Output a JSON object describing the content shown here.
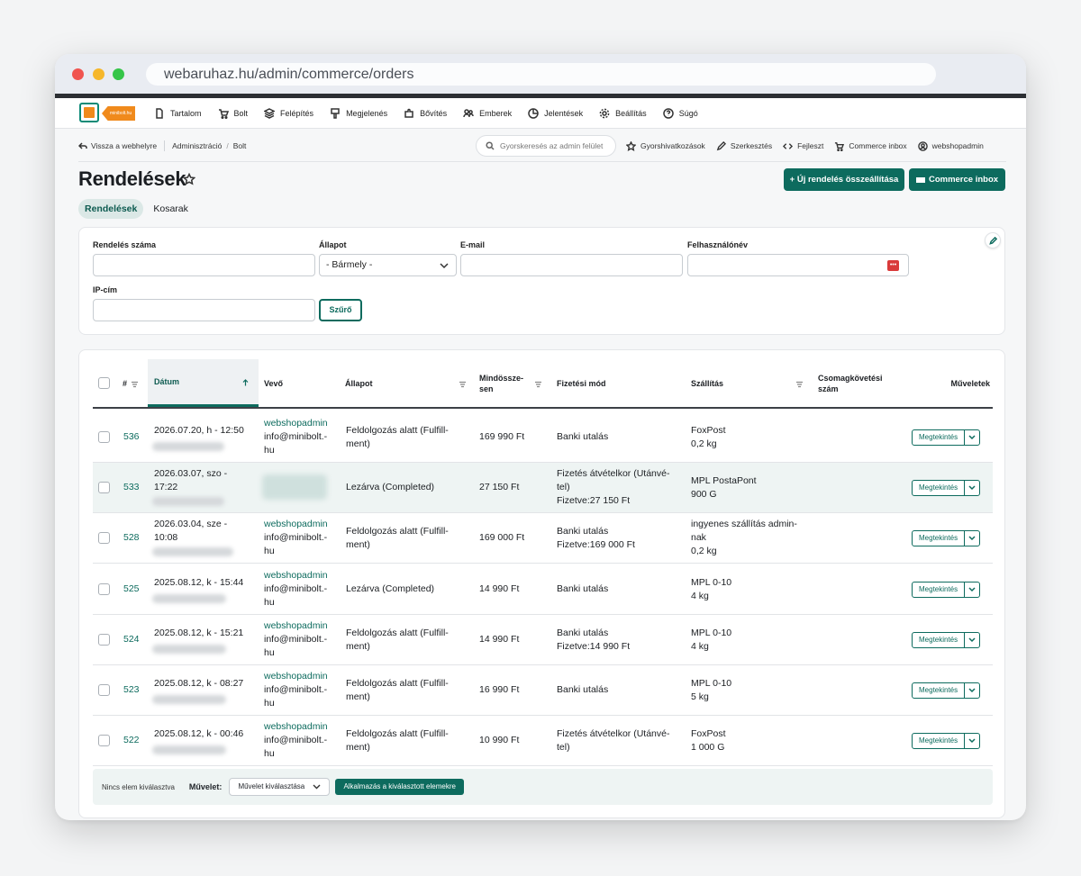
{
  "browser": {
    "url": "webaruhaz.hu/admin/commerce/orders"
  },
  "logo": {
    "text": "minibolt.hu"
  },
  "menu": [
    {
      "label": "Tartalom",
      "icon": "file-icon"
    },
    {
      "label": "Bolt",
      "icon": "cart-icon"
    },
    {
      "label": "Felépítés",
      "icon": "layers-icon"
    },
    {
      "label": "Megjelenés",
      "icon": "brush-icon"
    },
    {
      "label": "Bővítés",
      "icon": "puzzle-icon"
    },
    {
      "label": "Emberek",
      "icon": "people-icon"
    },
    {
      "label": "Jelentések",
      "icon": "chart-icon"
    },
    {
      "label": "Beállítás",
      "icon": "gear-icon"
    },
    {
      "label": "Súgó",
      "icon": "help-icon"
    }
  ],
  "subbar": {
    "back": "Vissza a webhelyre",
    "crumb1": "Adminisztráció",
    "crumb2": "Bolt",
    "search_placeholder": "Gyorskeresés az admin felület",
    "shortcuts": "Gyorshivatkozások",
    "edit": "Szerkesztés",
    "develop": "Fejleszt",
    "inbox": "Commerce inbox",
    "user": "webshopadmin"
  },
  "page": {
    "title": "Rendelések",
    "new_order": "+ Új rendelés összeállítása",
    "inbox_btn": "Commerce inbox",
    "tabs": [
      "Rendelések",
      "Kosarak"
    ]
  },
  "filters": {
    "order_number": "Rendelés száma",
    "status": "Állapot",
    "status_value": "- Bármely -",
    "email": "E-mail",
    "username": "Felhasználónév",
    "ip": "IP-cím",
    "submit": "Szűrő"
  },
  "table": {
    "headers": {
      "num": "#",
      "date": "Dátum",
      "customer": "Vevő",
      "status": "Állapot",
      "total": "Mindössze-\nsen",
      "payment": "Fizetési mód",
      "shipping": "Szállítás",
      "tracking": "Csomagkövetési\nszám",
      "actions": "Műveletek"
    },
    "view_label": "Megtekintés",
    "rows": [
      {
        "id": "536",
        "date": "2026.07.20, h - 12:50",
        "name": "webshopadmin",
        "email": "info@minibolt.-\nhu",
        "status": "Feldolgozás alatt (Fulfill-\nment)",
        "total": "169 990 Ft",
        "payment": "Banki utalás",
        "shipping": "FoxPost\n0,2 kg"
      },
      {
        "id": "533",
        "date": "2026.03.07, szo -\n17:22",
        "name": "",
        "email": "",
        "status": "Lezárva (Completed)",
        "total": "27 150 Ft",
        "payment": "Fizetés átvételkor (Utánvé-\ntel)\nFizetve:27 150 Ft",
        "shipping": "MPL PostaPont\n900 G"
      },
      {
        "id": "528",
        "date": "2026.03.04, sze -\n10:08",
        "name": "webshopadmin",
        "email": "info@minibolt.-\nhu",
        "status": "Feldolgozás alatt (Fulfill-\nment)",
        "total": "169 000 Ft",
        "payment": "Banki utalás\nFizetve:169 000 Ft",
        "shipping": "ingyenes szállítás admin-\nnak\n0,2 kg"
      },
      {
        "id": "525",
        "date": "2025.08.12, k - 15:44",
        "name": "webshopadmin",
        "email": "info@minibolt.-\nhu",
        "status": "Lezárva (Completed)",
        "total": "14 990 Ft",
        "payment": "Banki utalás",
        "shipping": "MPL 0-10\n4 kg"
      },
      {
        "id": "524",
        "date": "2025.08.12, k - 15:21",
        "name": "webshopadmin",
        "email": "info@minibolt.-\nhu",
        "status": "Feldolgozás alatt (Fulfill-\nment)",
        "total": "14 990 Ft",
        "payment": "Banki utalás\nFizetve:14 990 Ft",
        "shipping": "MPL 0-10\n4 kg"
      },
      {
        "id": "523",
        "date": "2025.08.12, k - 08:27",
        "name": "webshopadmin",
        "email": "info@minibolt.-\nhu",
        "status": "Feldolgozás alatt (Fulfill-\nment)",
        "total": "16 990 Ft",
        "payment": "Banki utalás",
        "shipping": "MPL 0-10\n5 kg"
      },
      {
        "id": "522",
        "date": "2025.08.12, k - 00:46",
        "name": "webshopadmin",
        "email": "info@minibolt.-\nhu",
        "status": "Feldolgozás alatt (Fulfill-\nment)",
        "total": "10 990 Ft",
        "payment": "Fizetés átvételkor (Utánvé-\ntel)",
        "shipping": "FoxPost\n1 000 G"
      }
    ]
  },
  "bulk": {
    "none_selected": "Nincs elem kiválasztva",
    "action_label": "Művelet:",
    "select_placeholder": "Művelet kiválasztása",
    "apply": "Alkalmazás a kiválasztott elemekre"
  },
  "colors": {
    "accent": "#0d6b5e",
    "brand_orange": "#f08a1c"
  }
}
